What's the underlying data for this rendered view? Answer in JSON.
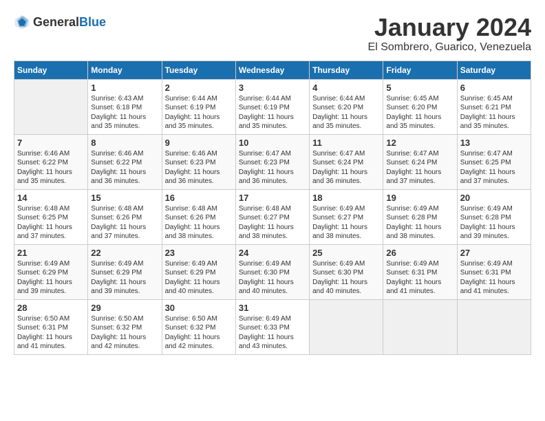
{
  "logo": {
    "general": "General",
    "blue": "Blue"
  },
  "title": "January 2024",
  "location": "El Sombrero, Guarico, Venezuela",
  "weekdays": [
    "Sunday",
    "Monday",
    "Tuesday",
    "Wednesday",
    "Thursday",
    "Friday",
    "Saturday"
  ],
  "weeks": [
    [
      {
        "day": "",
        "info": ""
      },
      {
        "day": "1",
        "info": "Sunrise: 6:43 AM\nSunset: 6:18 PM\nDaylight: 11 hours\nand 35 minutes."
      },
      {
        "day": "2",
        "info": "Sunrise: 6:44 AM\nSunset: 6:19 PM\nDaylight: 11 hours\nand 35 minutes."
      },
      {
        "day": "3",
        "info": "Sunrise: 6:44 AM\nSunset: 6:19 PM\nDaylight: 11 hours\nand 35 minutes."
      },
      {
        "day": "4",
        "info": "Sunrise: 6:44 AM\nSunset: 6:20 PM\nDaylight: 11 hours\nand 35 minutes."
      },
      {
        "day": "5",
        "info": "Sunrise: 6:45 AM\nSunset: 6:20 PM\nDaylight: 11 hours\nand 35 minutes."
      },
      {
        "day": "6",
        "info": "Sunrise: 6:45 AM\nSunset: 6:21 PM\nDaylight: 11 hours\nand 35 minutes."
      }
    ],
    [
      {
        "day": "7",
        "info": "Sunrise: 6:46 AM\nSunset: 6:22 PM\nDaylight: 11 hours\nand 35 minutes."
      },
      {
        "day": "8",
        "info": "Sunrise: 6:46 AM\nSunset: 6:22 PM\nDaylight: 11 hours\nand 36 minutes."
      },
      {
        "day": "9",
        "info": "Sunrise: 6:46 AM\nSunset: 6:23 PM\nDaylight: 11 hours\nand 36 minutes."
      },
      {
        "day": "10",
        "info": "Sunrise: 6:47 AM\nSunset: 6:23 PM\nDaylight: 11 hours\nand 36 minutes."
      },
      {
        "day": "11",
        "info": "Sunrise: 6:47 AM\nSunset: 6:24 PM\nDaylight: 11 hours\nand 36 minutes."
      },
      {
        "day": "12",
        "info": "Sunrise: 6:47 AM\nSunset: 6:24 PM\nDaylight: 11 hours\nand 37 minutes."
      },
      {
        "day": "13",
        "info": "Sunrise: 6:47 AM\nSunset: 6:25 PM\nDaylight: 11 hours\nand 37 minutes."
      }
    ],
    [
      {
        "day": "14",
        "info": "Sunrise: 6:48 AM\nSunset: 6:25 PM\nDaylight: 11 hours\nand 37 minutes."
      },
      {
        "day": "15",
        "info": "Sunrise: 6:48 AM\nSunset: 6:26 PM\nDaylight: 11 hours\nand 37 minutes."
      },
      {
        "day": "16",
        "info": "Sunrise: 6:48 AM\nSunset: 6:26 PM\nDaylight: 11 hours\nand 38 minutes."
      },
      {
        "day": "17",
        "info": "Sunrise: 6:48 AM\nSunset: 6:27 PM\nDaylight: 11 hours\nand 38 minutes."
      },
      {
        "day": "18",
        "info": "Sunrise: 6:49 AM\nSunset: 6:27 PM\nDaylight: 11 hours\nand 38 minutes."
      },
      {
        "day": "19",
        "info": "Sunrise: 6:49 AM\nSunset: 6:28 PM\nDaylight: 11 hours\nand 38 minutes."
      },
      {
        "day": "20",
        "info": "Sunrise: 6:49 AM\nSunset: 6:28 PM\nDaylight: 11 hours\nand 39 minutes."
      }
    ],
    [
      {
        "day": "21",
        "info": "Sunrise: 6:49 AM\nSunset: 6:29 PM\nDaylight: 11 hours\nand 39 minutes."
      },
      {
        "day": "22",
        "info": "Sunrise: 6:49 AM\nSunset: 6:29 PM\nDaylight: 11 hours\nand 39 minutes."
      },
      {
        "day": "23",
        "info": "Sunrise: 6:49 AM\nSunset: 6:29 PM\nDaylight: 11 hours\nand 40 minutes."
      },
      {
        "day": "24",
        "info": "Sunrise: 6:49 AM\nSunset: 6:30 PM\nDaylight: 11 hours\nand 40 minutes."
      },
      {
        "day": "25",
        "info": "Sunrise: 6:49 AM\nSunset: 6:30 PM\nDaylight: 11 hours\nand 40 minutes."
      },
      {
        "day": "26",
        "info": "Sunrise: 6:49 AM\nSunset: 6:31 PM\nDaylight: 11 hours\nand 41 minutes."
      },
      {
        "day": "27",
        "info": "Sunrise: 6:49 AM\nSunset: 6:31 PM\nDaylight: 11 hours\nand 41 minutes."
      }
    ],
    [
      {
        "day": "28",
        "info": "Sunrise: 6:50 AM\nSunset: 6:31 PM\nDaylight: 11 hours\nand 41 minutes."
      },
      {
        "day": "29",
        "info": "Sunrise: 6:50 AM\nSunset: 6:32 PM\nDaylight: 11 hours\nand 42 minutes."
      },
      {
        "day": "30",
        "info": "Sunrise: 6:50 AM\nSunset: 6:32 PM\nDaylight: 11 hours\nand 42 minutes."
      },
      {
        "day": "31",
        "info": "Sunrise: 6:49 AM\nSunset: 6:33 PM\nDaylight: 11 hours\nand 43 minutes."
      },
      {
        "day": "",
        "info": ""
      },
      {
        "day": "",
        "info": ""
      },
      {
        "day": "",
        "info": ""
      }
    ]
  ]
}
